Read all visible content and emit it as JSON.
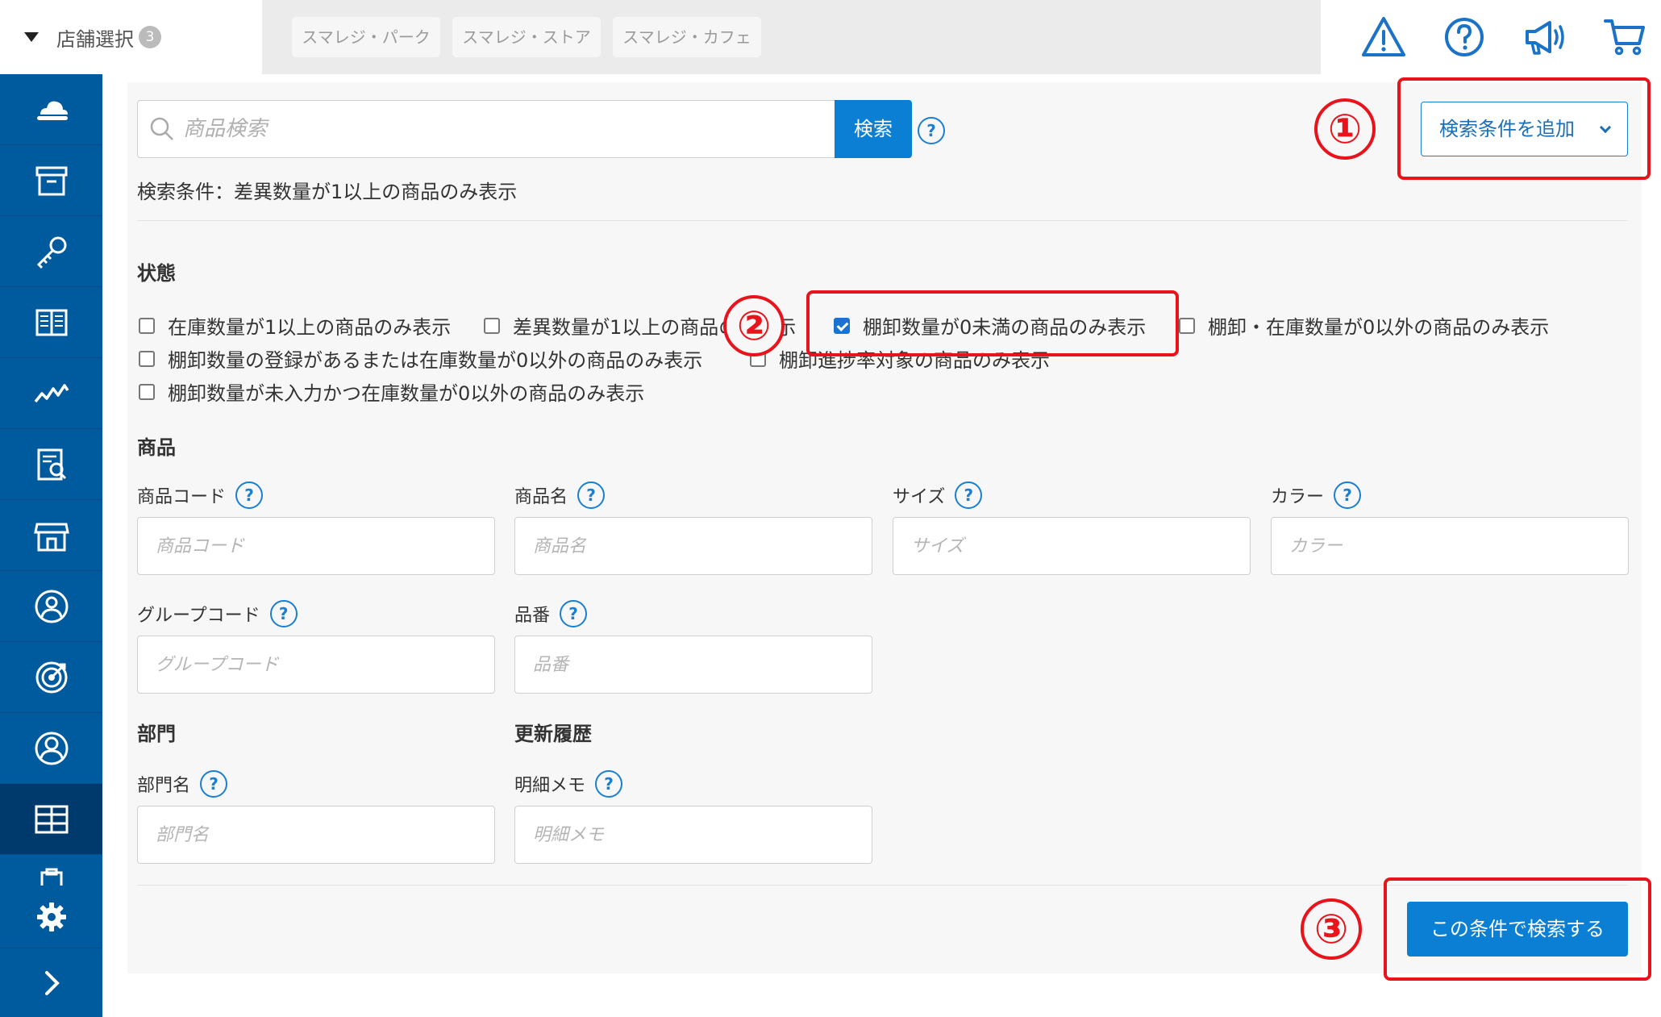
{
  "topbar": {
    "store_select_label": "店舗選択",
    "store_count": "3",
    "stores": [
      "スマレジ・パーク",
      "スマレジ・ストア",
      "スマレジ・カフェ"
    ]
  },
  "icons": {
    "top": [
      "warning-icon",
      "help-circle-icon",
      "megaphone-icon",
      "cart-icon"
    ],
    "sidebar": [
      "cloud-icon",
      "archive-box-icon",
      "key-icon",
      "book-icon",
      "line-chart-icon",
      "report-icon",
      "store-icon",
      "person-circle-icon",
      "target-icon",
      "user-circle-icon",
      "grid-icon",
      "clipboard-icon",
      "gear-icon",
      "chevron-right-icon"
    ]
  },
  "search": {
    "placeholder": "商品検索",
    "button_label": "検索",
    "add_condition_label": "検索条件を追加",
    "condition_summary": "検索条件：差異数量が1以上の商品のみ表示"
  },
  "status_section": {
    "title": "状態",
    "options": [
      {
        "label": "在庫数量が1以上の商品のみ表示",
        "checked": false
      },
      {
        "label": "差異数量が1以上の商品のみ表示",
        "checked": false
      },
      {
        "label": "棚卸数量が0未満の商品のみ表示",
        "checked": true
      },
      {
        "label": "棚卸・在庫数量が0以外の商品のみ表示",
        "checked": false
      },
      {
        "label": "棚卸数量の登録があるまたは在庫数量が0以外の商品のみ表示",
        "checked": false
      },
      {
        "label": "棚卸進捗率対象の商品のみ表示",
        "checked": false
      },
      {
        "label": "棚卸数量が未入力かつ在庫数量が0以外の商品のみ表示",
        "checked": false
      }
    ]
  },
  "product_section": {
    "title": "商品",
    "fields": [
      {
        "label": "商品コード",
        "placeholder": "商品コード"
      },
      {
        "label": "商品名",
        "placeholder": "商品名"
      },
      {
        "label": "サイズ",
        "placeholder": "サイズ"
      },
      {
        "label": "カラー",
        "placeholder": "カラー"
      },
      {
        "label": "グループコード",
        "placeholder": "グループコード"
      },
      {
        "label": "品番",
        "placeholder": "品番"
      }
    ]
  },
  "category_section": {
    "title": "部門",
    "field": {
      "label": "部門名",
      "placeholder": "部門名"
    }
  },
  "history_section": {
    "title": "更新履歴",
    "field": {
      "label": "明細メモ",
      "placeholder": "明細メモ"
    }
  },
  "submit_label": "この条件で検索する",
  "annotations": [
    "①",
    "②",
    "③"
  ],
  "help_glyph": "?",
  "colors": {
    "sidebar": "#005a9e",
    "primary": "#0a7fd4",
    "annotation": "#e8131b"
  }
}
